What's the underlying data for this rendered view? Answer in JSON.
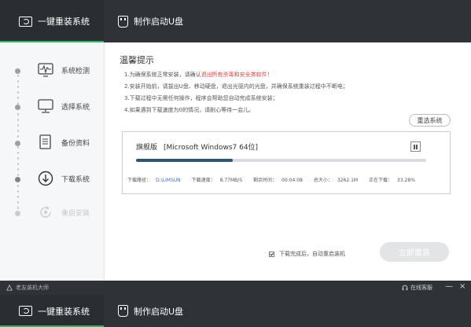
{
  "tabs": [
    {
      "label": "一键重装系统",
      "icon": "monitor-icon",
      "active": true
    },
    {
      "label": "制作启动U盘",
      "icon": "usb-icon",
      "active": false
    }
  ],
  "sidebar": {
    "steps": [
      {
        "label": "系统检测",
        "icon": "pulse-monitor-icon",
        "state": "done"
      },
      {
        "label": "选择系统",
        "icon": "monitor-icon",
        "state": "done"
      },
      {
        "label": "备份资料",
        "icon": "document-icon",
        "state": "done"
      },
      {
        "label": "下载系统",
        "icon": "download-circle-icon",
        "state": "current"
      },
      {
        "label": "重启安装",
        "icon": "restart-icon",
        "state": "pending"
      }
    ]
  },
  "main": {
    "title": "温馨提示",
    "tips": [
      {
        "prefix": "1.为确保系统正常安装，请确认",
        "highlight": "退出所有杀毒和安全类软件！"
      },
      {
        "prefix": "2.安装开始前，请拔出U盘、移动硬盘，退出光驱内的光盘，并确保系统重装过程中不断电；",
        "highlight": ""
      },
      {
        "prefix": "3.下载过程中无需任何操作，程序会帮助您自动完成系统安装；",
        "highlight": ""
      },
      {
        "prefix": "4.如果遇到下载速度为0的情况，请耐心等待一会儿。",
        "highlight": ""
      }
    ],
    "reselect_label": "重选系统",
    "download": {
      "edition": "旗舰版",
      "system_name": "[Microsoft Windows7 64位]",
      "progress_percent": 33.28,
      "path_label": "下载路径：",
      "path_value": "D:\\LIMSUN",
      "speed_label": "下载速度：",
      "speed_value": "8.77MB/S",
      "remaining_label": "剩余时间：",
      "remaining_value": "00:04:08",
      "size_label": "总大小：",
      "size_value": "3262.1M",
      "downloading_label": "正在下载：",
      "downloading_value": "33.28%"
    },
    "auto_restart_label": "下载完成后，自动重启装机",
    "auto_restart_checked": true,
    "install_label": "立即重装"
  },
  "statusbar": {
    "brand": "老友装机大师",
    "online_service": "在线客服",
    "minimize": "—",
    "close": "×"
  },
  "colors": {
    "accent": "#2db760",
    "header_bg": "#2f3237",
    "progress": "#33566f",
    "warning": "#e04040"
  }
}
